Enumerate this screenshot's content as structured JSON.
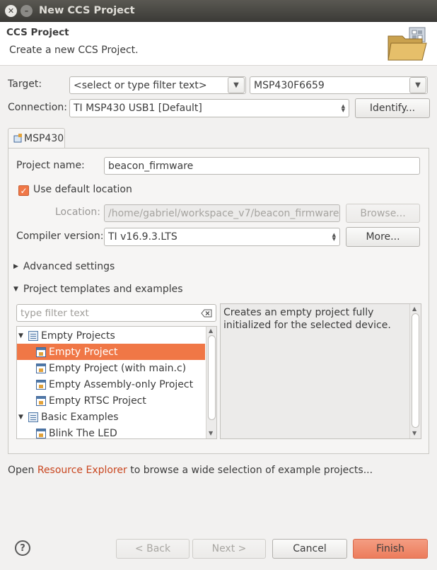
{
  "window": {
    "title": "New CCS Project"
  },
  "header": {
    "title": "CCS Project",
    "description": "Create a new CCS Project.",
    "icon": "folder-wizard-icon"
  },
  "target": {
    "label": "Target:",
    "filter_value": "<select or type filter text>",
    "device_value": "MSP430F6659"
  },
  "connection": {
    "label": "Connection:",
    "value": "TI MSP430 USB1 [Default]",
    "identify_label": "Identify..."
  },
  "tab": {
    "label": "MSP430",
    "icon": "chip-icon"
  },
  "project": {
    "name_label": "Project name:",
    "name_value": "beacon_firmware",
    "default_location_label": "Use default location",
    "default_location_checked": true,
    "location_label": "Location:",
    "location_value": "/home/gabriel/workspace_v7/beacon_firmware",
    "browse_label": "Browse...",
    "compiler_label": "Compiler version:",
    "compiler_value": "TI v16.9.3.LTS",
    "more_label": "More..."
  },
  "sections": {
    "advanced": "Advanced settings",
    "templates": "Project templates and examples"
  },
  "templates": {
    "filter_placeholder": "type filter text",
    "tree": [
      {
        "label": "Empty Projects",
        "type": "folder",
        "level": 0,
        "expanded": true,
        "selected": false
      },
      {
        "label": "Empty Project",
        "type": "project",
        "level": 1,
        "selected": true
      },
      {
        "label": "Empty Project (with main.c)",
        "type": "project",
        "level": 1,
        "selected": false
      },
      {
        "label": "Empty Assembly-only Project",
        "type": "project",
        "level": 1,
        "selected": false
      },
      {
        "label": "Empty RTSC Project",
        "type": "project",
        "level": 1,
        "selected": false
      },
      {
        "label": "Basic Examples",
        "type": "folder",
        "level": 0,
        "expanded": true,
        "selected": false
      },
      {
        "label": "Blink The LED",
        "type": "project",
        "level": 1,
        "selected": false
      }
    ],
    "description": "Creates an empty project fully initialized for the selected device."
  },
  "footer_text": {
    "prefix": "Open ",
    "link": "Resource Explorer",
    "suffix": " to browse a wide selection of example projects..."
  },
  "buttons": {
    "back": "< Back",
    "next": "Next >",
    "cancel": "Cancel",
    "finish": "Finish",
    "help": "?"
  },
  "colors": {
    "accent": "#f07746",
    "link": "#c9461f",
    "titlebar": "#3c3b37"
  }
}
